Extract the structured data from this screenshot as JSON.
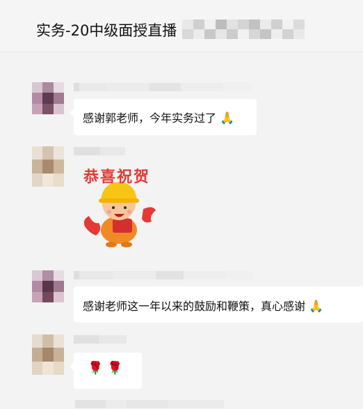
{
  "header": {
    "title": "实务-20中级面授直播"
  },
  "messages": [
    {
      "text": "感谢郭老师，今年实务过了",
      "emoji": "🙏"
    },
    {
      "sticker_text": "恭喜祝贺"
    },
    {
      "text": "感谢老师这一年以来的鼓励和鞭策，真心感谢",
      "emoji": "🙏"
    },
    {
      "roses": "🌹 🌹"
    }
  ],
  "colors": {
    "background": "#f3f3f3",
    "bubble": "#ffffff",
    "sticker_red": "#e53935",
    "helmet": "#f9c515"
  }
}
